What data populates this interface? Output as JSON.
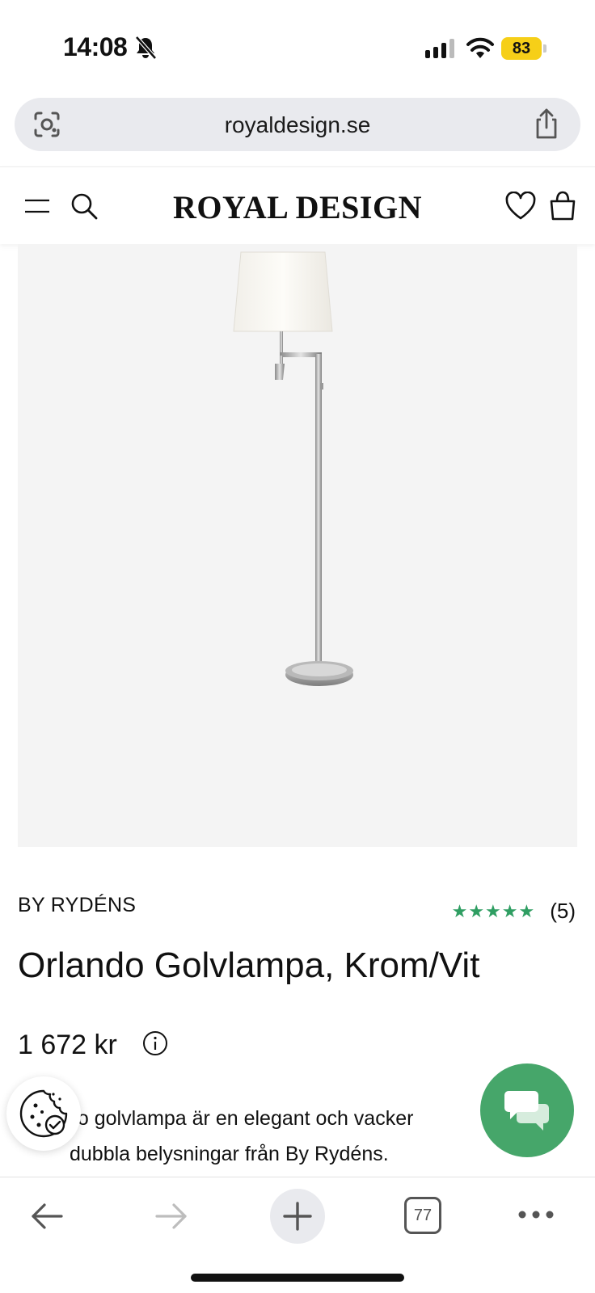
{
  "status_bar": {
    "time": "14:08",
    "battery": "83"
  },
  "browser": {
    "address": "royaldesign.se",
    "tab_count": "77"
  },
  "site": {
    "logo": "ROYAL DESIGN"
  },
  "product": {
    "brand": "BY RYDÉNS",
    "stars": "★★★★★",
    "rating_value": 5,
    "review_count": "(5)",
    "title": "Orlando Golvlampa, Krom/Vit",
    "price": "1 672 kr",
    "description_line1": "do golvlampa är en elegant och vacker",
    "description_line2": "dubbla belysningar från By Rydéns."
  },
  "colors": {
    "accent_green": "#46a66a",
    "star_green": "#2f9e62",
    "battery_yellow": "#f6cf18",
    "image_bg": "#f4f4f4"
  },
  "icons": [
    "bell-slash-icon",
    "signal-icon",
    "wifi-icon",
    "camera-lens-icon",
    "share-icon",
    "menu-icon",
    "search-icon",
    "heart-icon",
    "bag-icon",
    "info-icon",
    "cookie-icon",
    "chat-icon",
    "back-arrow-icon",
    "forward-arrow-icon",
    "plus-icon",
    "more-icon"
  ]
}
